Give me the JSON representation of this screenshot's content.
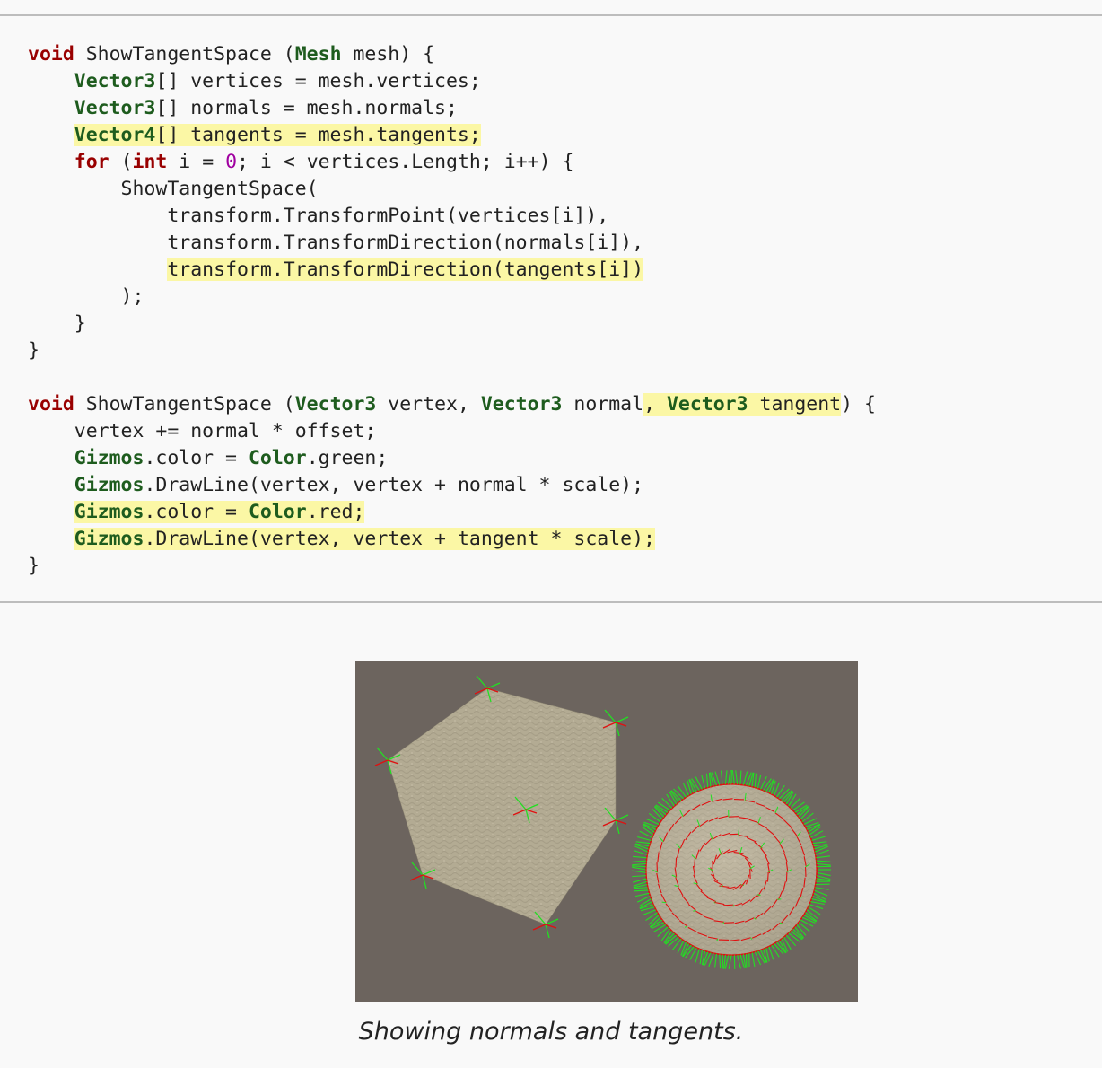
{
  "code_lines": [
    [
      [
        "kw",
        "void"
      ],
      [
        "t",
        " ShowTangentSpace ("
      ],
      [
        "ty",
        "Mesh"
      ],
      [
        "t",
        " mesh) {"
      ]
    ],
    [
      [
        "t",
        "    "
      ],
      [
        "ty",
        "Vector3"
      ],
      [
        "t",
        "[] vertices = mesh.vertices;"
      ]
    ],
    [
      [
        "t",
        "    "
      ],
      [
        "ty",
        "Vector3"
      ],
      [
        "t",
        "[] normals = mesh.normals;"
      ]
    ],
    [
      [
        "t",
        "    "
      ],
      [
        "hl",
        [
          [
            "ty",
            "Vector4"
          ],
          [
            "t",
            "[] tangents = mesh.tangents;"
          ]
        ]
      ]
    ],
    [
      [
        "t",
        "    "
      ],
      [
        "kw",
        "for"
      ],
      [
        "t",
        " ("
      ],
      [
        "kw",
        "int"
      ],
      [
        "t",
        " i = "
      ],
      [
        "num",
        "0"
      ],
      [
        "t",
        "; i < vertices.Length; i++) {"
      ]
    ],
    [
      [
        "t",
        "        ShowTangentSpace("
      ]
    ],
    [
      [
        "t",
        "            transform.TransformPoint(vertices[i]),"
      ]
    ],
    [
      [
        "t",
        "            transform.TransformDirection(normals[i]),"
      ]
    ],
    [
      [
        "t",
        "            "
      ],
      [
        "hl",
        [
          [
            "t",
            "transform.TransformDirection(tangents[i])"
          ]
        ]
      ]
    ],
    [
      [
        "t",
        "        );"
      ]
    ],
    [
      [
        "t",
        "    }"
      ]
    ],
    [
      [
        "t",
        "}"
      ]
    ],
    [
      [
        "t",
        ""
      ]
    ],
    [
      [
        "kw",
        "void"
      ],
      [
        "t",
        " ShowTangentSpace ("
      ],
      [
        "ty",
        "Vector3"
      ],
      [
        "t",
        " vertex, "
      ],
      [
        "ty",
        "Vector3"
      ],
      [
        "t",
        " normal"
      ],
      [
        "hl",
        [
          [
            "t",
            ", "
          ],
          [
            "ty",
            "Vector3"
          ],
          [
            "t",
            " tangent"
          ]
        ]
      ],
      [
        "t",
        ") {"
      ]
    ],
    [
      [
        "t",
        "    vertex += normal * offset;"
      ]
    ],
    [
      [
        "t",
        "    "
      ],
      [
        "ty",
        "Gizmos"
      ],
      [
        "t",
        ".color = "
      ],
      [
        "ty",
        "Color"
      ],
      [
        "t",
        ".green;"
      ]
    ],
    [
      [
        "t",
        "    "
      ],
      [
        "ty",
        "Gizmos"
      ],
      [
        "t",
        ".DrawLine(vertex, vertex + normal * scale);"
      ]
    ],
    [
      [
        "t",
        "    "
      ],
      [
        "hl",
        [
          [
            "ty",
            "Gizmos"
          ],
          [
            "t",
            ".color = "
          ],
          [
            "ty",
            "Color"
          ],
          [
            "t",
            ".red;"
          ]
        ]
      ]
    ],
    [
      [
        "t",
        "    "
      ],
      [
        "hl",
        [
          [
            "ty",
            "Gizmos"
          ],
          [
            "t",
            ".DrawLine(vertex, vertex + tangent * scale);"
          ]
        ]
      ]
    ],
    [
      [
        "t",
        "}"
      ]
    ]
  ],
  "figure": {
    "background": "#6c645e",
    "normal_color": "#22e022",
    "tangent_color": "#e01010"
  },
  "caption": "Showing normals and tangents."
}
